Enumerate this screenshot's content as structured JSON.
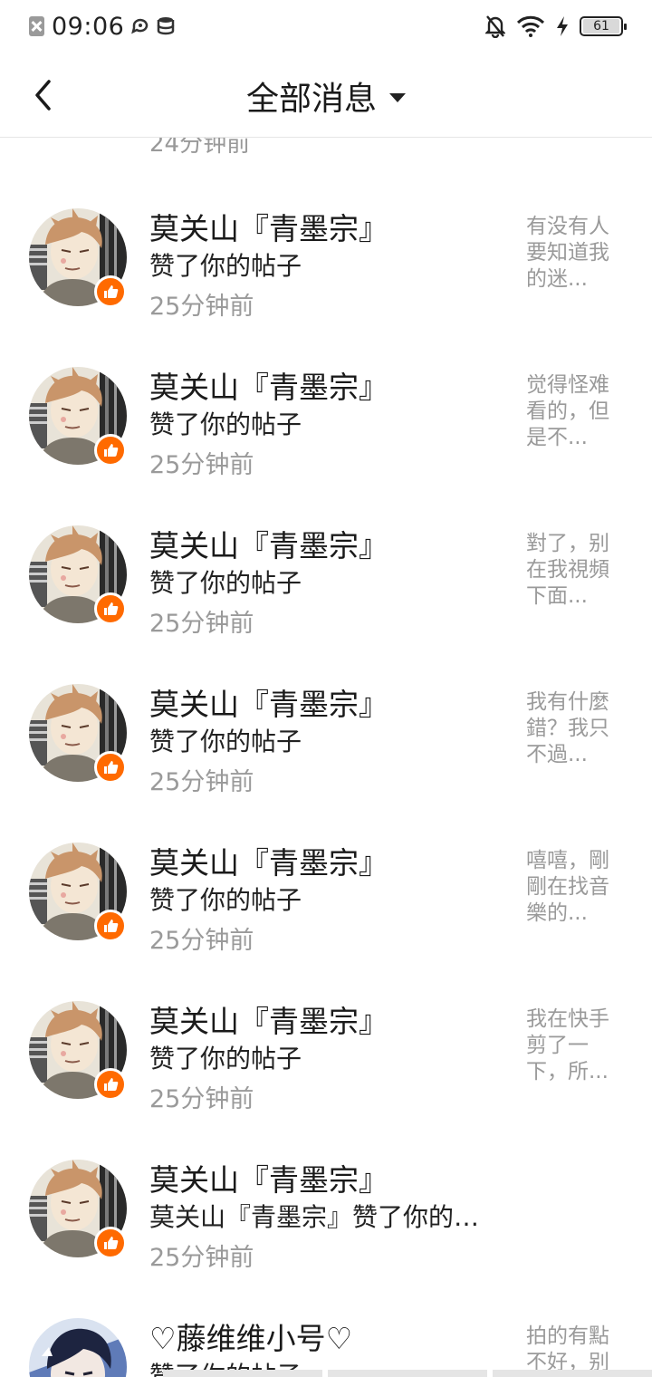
{
  "status_bar": {
    "time": "09:06",
    "battery": "61"
  },
  "header": {
    "title": "全部消息"
  },
  "partial_top_row": {
    "time": "24分钟前"
  },
  "items": [
    {
      "name": "莫关山『青墨宗』",
      "action": "赞了你的帖子",
      "time": "25分钟前",
      "preview": "有没有人要知道我的迷..."
    },
    {
      "name": "莫关山『青墨宗』",
      "action": "赞了你的帖子",
      "time": "25分钟前",
      "preview": "觉得怪难看的，但是不..."
    },
    {
      "name": "莫关山『青墨宗』",
      "action": "赞了你的帖子",
      "time": "25分钟前",
      "preview": "對了，别在我視頻下面..."
    },
    {
      "name": "莫关山『青墨宗』",
      "action": "赞了你的帖子",
      "time": "25分钟前",
      "preview": "我有什麼錯？我只不過..."
    },
    {
      "name": "莫关山『青墨宗』",
      "action": "赞了你的帖子",
      "time": "25分钟前",
      "preview": "嘻嘻，剛剛在找音樂的..."
    },
    {
      "name": "莫关山『青墨宗』",
      "action": "赞了你的帖子",
      "time": "25分钟前",
      "preview": "我在快手剪了一下，所..."
    },
    {
      "name": "莫关山『青墨宗』",
      "action": "莫关山『青墨宗』赞了你的…",
      "time": "25分钟前",
      "preview": ""
    },
    {
      "name": "♡藤维维小号♡",
      "action": "赞了你的帖子",
      "time": "",
      "preview": "拍的有點不好，别看細..."
    }
  ],
  "colors": {
    "accent": "#ff6a00",
    "secondary_text": "#9a9a9a"
  },
  "icons": {
    "back": "chevron-left-icon",
    "dropdown": "caret-down-icon",
    "like": "thumbs-up-icon"
  }
}
